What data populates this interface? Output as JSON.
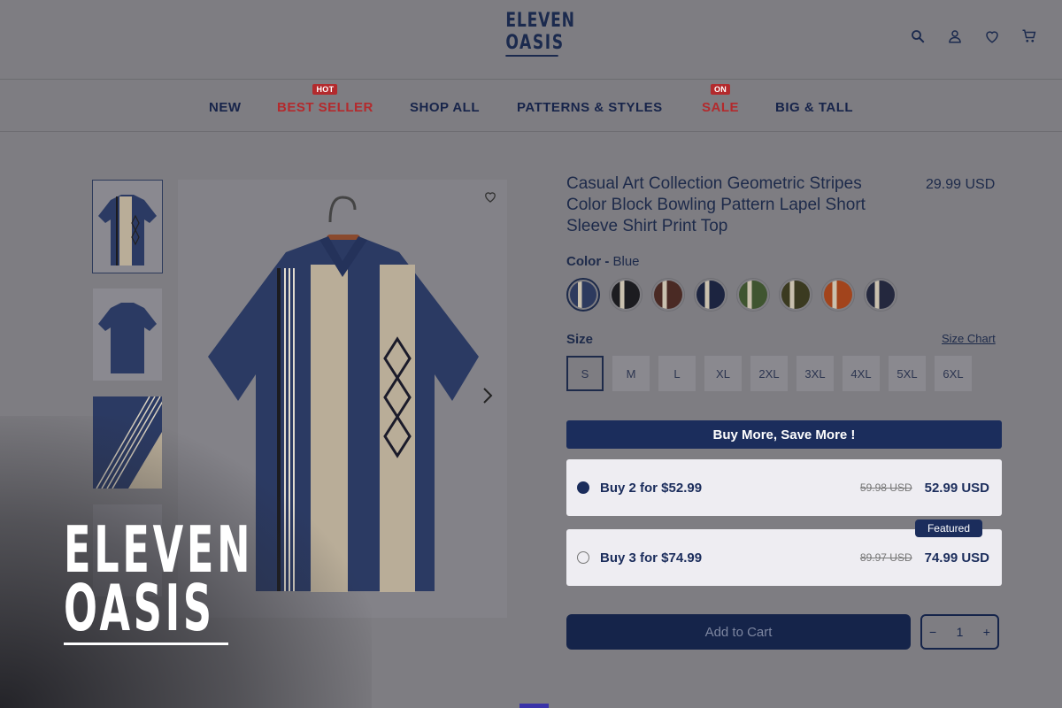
{
  "logo": {
    "line1": "ELEVEN",
    "line2": "OASIS"
  },
  "header_icons": [
    "search-icon",
    "account-icon",
    "heart-icon",
    "cart-icon"
  ],
  "nav": {
    "items": [
      {
        "label": "NEW",
        "badge": ""
      },
      {
        "label": "BEST SELLER",
        "badge": "HOT"
      },
      {
        "label": "SHOP ALL",
        "badge": ""
      },
      {
        "label": "PATTERNS & STYLES",
        "badge": ""
      },
      {
        "label": "SALE",
        "badge": "ON"
      },
      {
        "label": "BIG & TALL",
        "badge": ""
      }
    ]
  },
  "product": {
    "title": "Casual Art Collection Geometric Stripes Color Block Bowling Pattern Lapel Short Sleeve Shirt Print Top",
    "price": "29.99 USD",
    "color_label": "Color -",
    "color_value": "Blue",
    "size_label": "Size",
    "size_chart": "Size Chart",
    "sizes": [
      "S",
      "M",
      "L",
      "XL",
      "2XL",
      "3XL",
      "4XL",
      "5XL",
      "6XL"
    ],
    "selected_size": "S",
    "swatch_colors": [
      "#2d3a5e",
      "#1c1c20",
      "#4a2a24",
      "#1c2440",
      "#3f5530",
      "#3b3a20",
      "#a2441c",
      "#24283e"
    ]
  },
  "bundles": {
    "banner": "Buy More, Save More !",
    "options": [
      {
        "label": "Buy 2 for $52.99",
        "old": "59.98 USD",
        "new": "52.99 USD",
        "selected": true
      },
      {
        "label": "Buy 3 for $74.99",
        "old": "89.97 USD",
        "new": "74.99 USD",
        "selected": false,
        "tag": "Featured"
      }
    ]
  },
  "cart": {
    "add_label": "Add to Cart",
    "qty": "1",
    "minus": "−",
    "plus": "+"
  },
  "overlay_brand": {
    "line1": "ELEVEN",
    "line2": "OASIS"
  }
}
